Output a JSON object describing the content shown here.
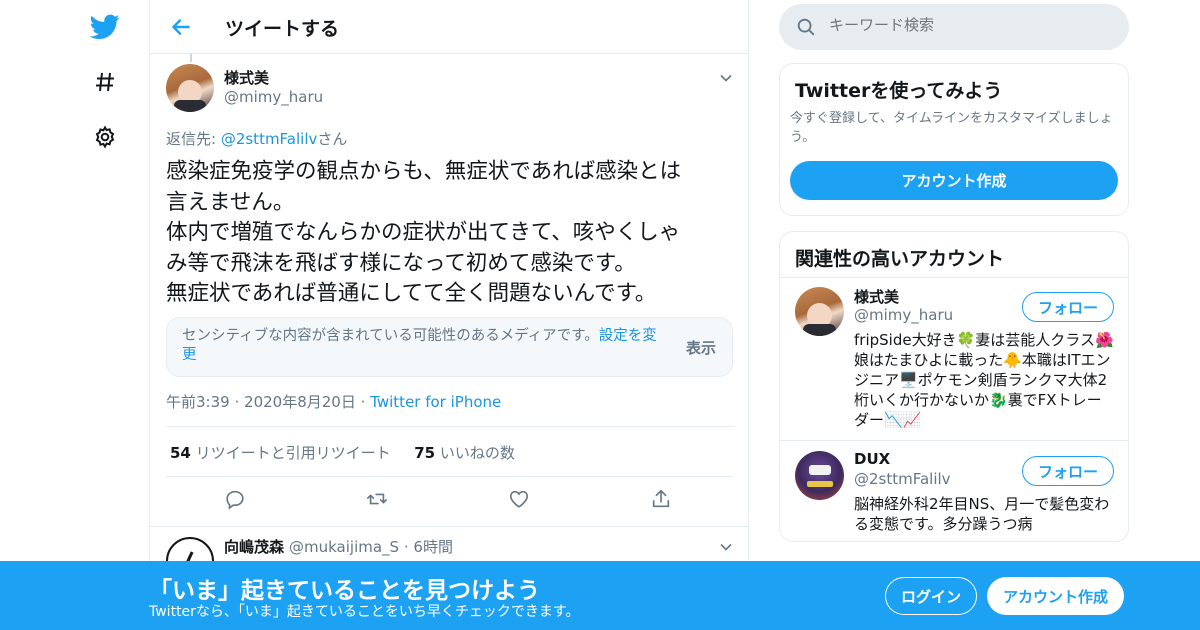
{
  "header": {
    "title": "ツイートする"
  },
  "tweet": {
    "author_name": "様式美",
    "author_handle": "@mimy_haru",
    "reply_prefix": "返信先: ",
    "reply_to": "@2sttmFalilv",
    "reply_suffix": "さん",
    "text": "感染症免疫学の観点からも、無症状であれば感染とは\n言えません。\n体内で増殖でなんらかの症状が出てきて、咳やくしゃ\nみ等で飛沫を飛ばす様になって初めて感染です。\n無症状であれば普通にしてて全く問題ないんです。",
    "sensitive_notice": "センシティブな内容が含まれている可能性のあるメディアです。",
    "sensitive_link": "設定を変更",
    "sensitive_show": "表示",
    "time": "午前3:39",
    "date": "2020年8月20日",
    "separator": "·",
    "source": "Twitter for iPhone",
    "retweet_count": "54",
    "retweet_label": "リツイートと引用リツイート",
    "like_count": "75",
    "like_label": "いいねの数"
  },
  "reply": {
    "name": "向嶋茂森",
    "handle": "@mukaijima_S",
    "separator": "·",
    "time": "6時間"
  },
  "search": {
    "placeholder": "キーワード検索"
  },
  "signup_card": {
    "title": "Twitterを使ってみよう",
    "description": "今すぐ登録して、タイムラインをカスタマイズしましょう。",
    "button": "アカウント作成"
  },
  "related": {
    "title": "関連性の高いアカウント",
    "follow_label": "フォロー",
    "accounts": [
      {
        "name": "様式美",
        "handle": "@mimy_haru",
        "bio": "fripSide大好き🍀妻は芸能人クラス🌺娘はたまひよに載った🐥本職はITエンジニア🖥️ポケモン剣盾ランクマ大体2桁いくか行かないか🐉裏でFXトレーダー📉📈"
      },
      {
        "name": "DUX",
        "handle": "@2sttmFalilv",
        "bio": "脳神経外科2年目NS、月一で髪色変わる変態です。多分躁うつ病"
      }
    ]
  },
  "banner": {
    "title": "「いま」起きていることを見つけよう",
    "subtitle": "Twitterなら、「いま」起きていることをいち早くチェックできます。",
    "login": "ログイン",
    "signup": "アカウント作成"
  },
  "colors": {
    "accent": "#1da1f2",
    "link": "#1b95e0",
    "muted": "#657786",
    "border": "#e6ecf0"
  },
  "icons": [
    "twitter-bird-icon",
    "hashtag-icon",
    "gear-icon",
    "back-arrow-icon",
    "chevron-down-icon",
    "reply-icon",
    "retweet-icon",
    "like-icon",
    "share-icon",
    "search-icon"
  ]
}
